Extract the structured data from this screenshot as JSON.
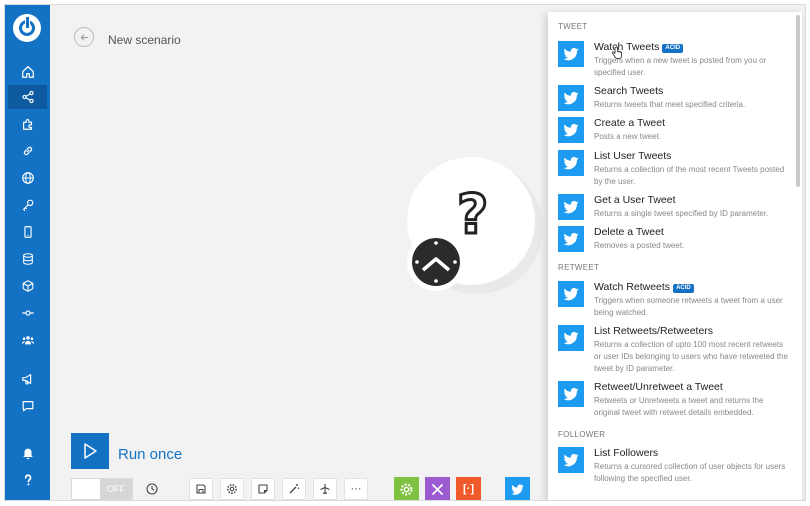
{
  "header": {
    "title": "New scenario"
  },
  "run": {
    "label": "Run once"
  },
  "toolbar": {
    "toggle_label": "OFF",
    "more_label": "···",
    "bracket_label": "[·]"
  },
  "colors": {
    "accent": "#1472c4",
    "twitter": "#1d9bf0",
    "green": "#7fc241",
    "purple": "#9d5bd2",
    "orange": "#f05a2a"
  },
  "sidebar": {
    "items": [
      {
        "icon": "home-icon"
      },
      {
        "icon": "share-icon"
      },
      {
        "icon": "puzzle-icon"
      },
      {
        "icon": "link-icon"
      },
      {
        "icon": "globe-icon"
      },
      {
        "icon": "key-icon"
      },
      {
        "icon": "device-icon"
      },
      {
        "icon": "database-icon"
      },
      {
        "icon": "cube-icon"
      },
      {
        "icon": "flow-icon"
      },
      {
        "icon": "team-icon"
      },
      {
        "icon": "megaphone-icon"
      },
      {
        "icon": "chat-icon"
      },
      {
        "icon": "bell-icon"
      },
      {
        "icon": "help-icon"
      }
    ]
  },
  "panel": {
    "sections": [
      {
        "label": "TWEET",
        "items": [
          {
            "name": "Watch Tweets",
            "badge": "ACID",
            "desc": "Triggers when a new tweet is posted from you or specified user."
          },
          {
            "name": "Search Tweets",
            "desc": "Returns tweets that meet specified criteria."
          },
          {
            "name": "Create a Tweet",
            "desc": "Posts a new tweet."
          },
          {
            "name": "List User Tweets",
            "desc": "Returns a collection of the most recent Tweets posted by the user."
          },
          {
            "name": "Get a User Tweet",
            "desc": "Returns a single tweet specified by ID parameter."
          },
          {
            "name": "Delete a Tweet",
            "desc": "Removes a posted tweet."
          }
        ]
      },
      {
        "label": "RETWEET",
        "items": [
          {
            "name": "Watch Retweets",
            "badge": "ACID",
            "desc": "Triggers when someone retweets a tweet from a user being watched."
          },
          {
            "name": "List Retweets/Retweeters",
            "desc": "Returns a collection of upto 100 most recent retweets or user IDs belonging to users who have retweeted the tweet by ID parameter."
          },
          {
            "name": "Retweet/Unretweet a Tweet",
            "desc": "Retweets or Unretweets a tweet and returns the original tweet with retweet details embedded."
          }
        ]
      },
      {
        "label": "FOLLOWER",
        "items": [
          {
            "name": "List Followers",
            "desc": "Returns a cursored collection of user objects for users following the specified user."
          }
        ]
      }
    ]
  }
}
